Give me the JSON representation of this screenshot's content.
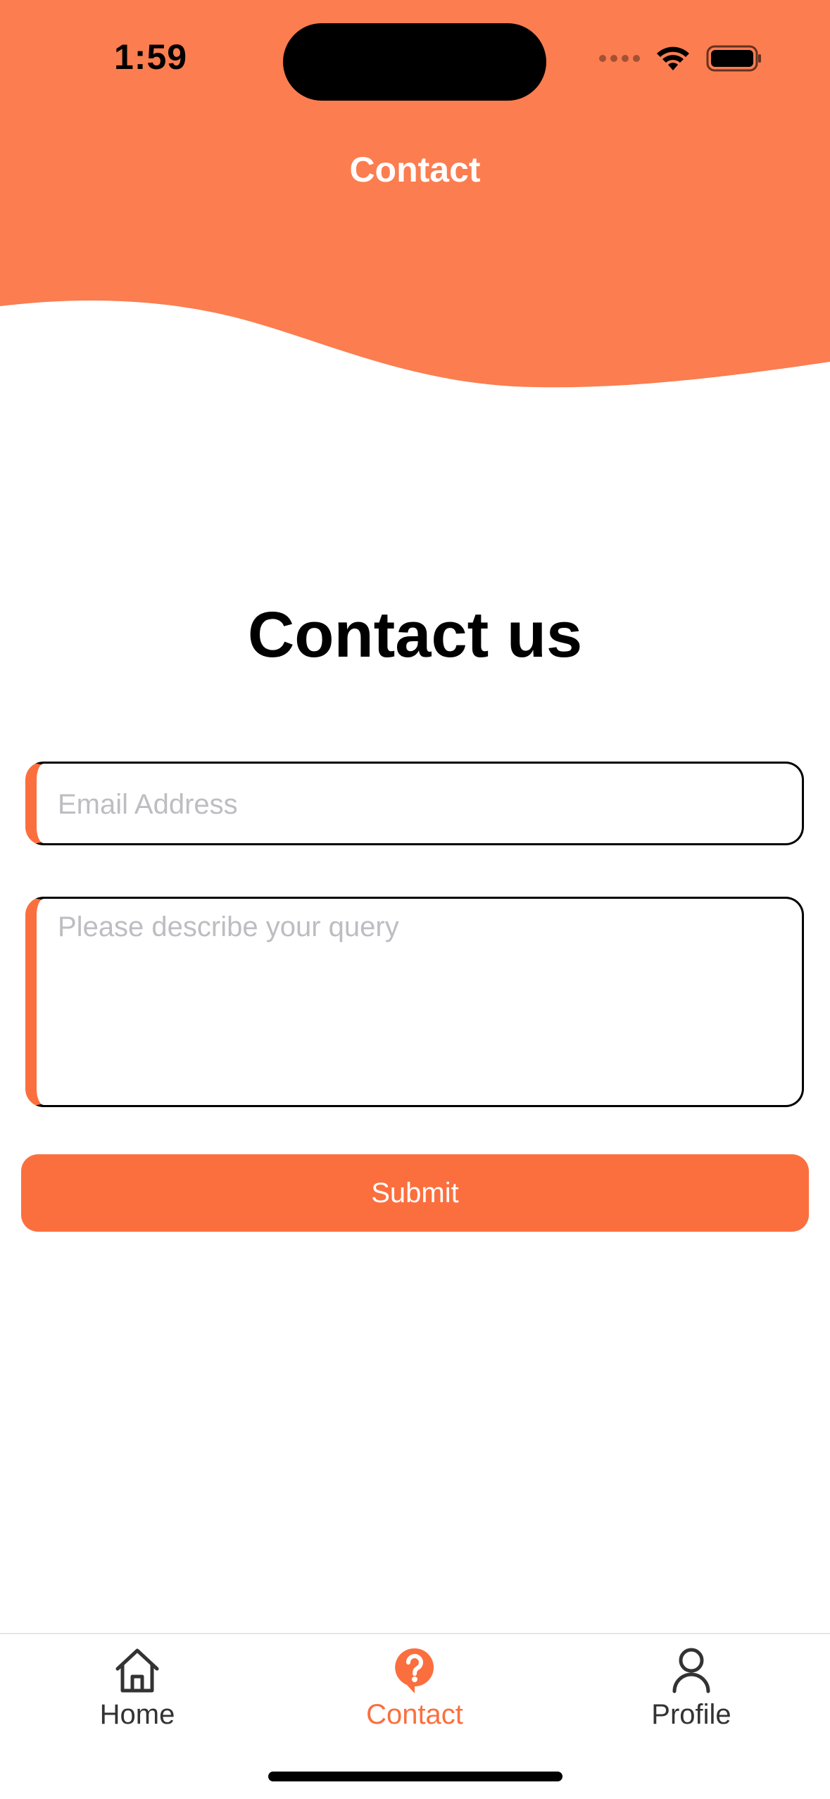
{
  "status_bar": {
    "time": "1:59"
  },
  "nav": {
    "title": "Contact"
  },
  "main": {
    "heading": "Contact us",
    "email_placeholder": "Email Address",
    "query_placeholder": "Please describe your query",
    "submit_label": "Submit"
  },
  "tab_bar": {
    "tabs": [
      {
        "label": "Home",
        "icon": "home-icon",
        "active": false
      },
      {
        "label": "Contact",
        "icon": "question-chat-icon",
        "active": true
      },
      {
        "label": "Profile",
        "icon": "person-icon",
        "active": false
      }
    ]
  },
  "colors": {
    "accent": "#FB7D50",
    "button": "#FB6F3E",
    "placeholder": "#BDBDC2"
  }
}
